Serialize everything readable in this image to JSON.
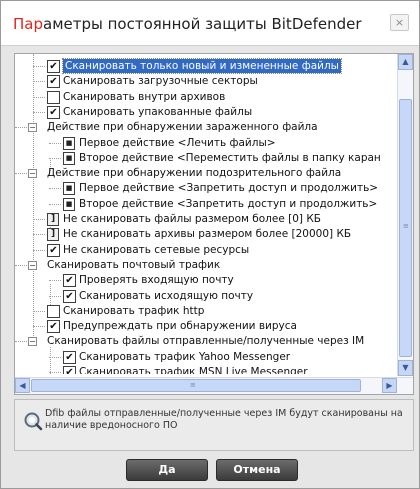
{
  "dialog": {
    "title_highlight": "Пар",
    "title_rest": "аметры постоянной защиты BitDefender",
    "close_glyph": "×"
  },
  "tree": [
    {
      "text": "Сканировать только новый и измененные файлы",
      "type": "checkbox",
      "checked": true,
      "selected": true
    },
    {
      "text": "Сканировать загрузочные секторы",
      "type": "checkbox",
      "checked": true
    },
    {
      "text": "Сканировать внутри архивов",
      "type": "checkbox",
      "checked": false
    },
    {
      "text": "Сканировать упакованные файлы",
      "type": "checkbox",
      "checked": true
    },
    {
      "text": "Действие при обнаружении зараженного файла",
      "type": "group"
    },
    {
      "text": "Первое действие <Лечить файлы>",
      "type": "action"
    },
    {
      "text": "Второе действие <Переместить файлы в папку каран",
      "type": "action"
    },
    {
      "text": "Действие при обнаружении подозрительного файла",
      "type": "group"
    },
    {
      "text": "Первое действие <Запретить доступ и продолжить>",
      "type": "action"
    },
    {
      "text": "Второе действие <Запретить доступ и продолжить>",
      "type": "action"
    },
    {
      "text": "Не сканировать файлы размером более [0] КБ",
      "type": "numeric"
    },
    {
      "text": "Не сканировать архивы размером более [20000] КБ",
      "type": "numeric"
    },
    {
      "text": "Не сканировать сетевые ресурсы",
      "type": "checkbox",
      "checked": true
    },
    {
      "text": "Сканировать почтовый трафик",
      "type": "group"
    },
    {
      "text": "Проверять входящую почту",
      "type": "checkbox",
      "checked": true
    },
    {
      "text": "Сканировать исходящую почту",
      "type": "checkbox",
      "checked": true
    },
    {
      "text": "Сканировать трафик http",
      "type": "checkbox",
      "checked": false
    },
    {
      "text": "Предупреждать при обнаружении вируса",
      "type": "checkbox",
      "checked": true
    },
    {
      "text": "Сканировать файлы отправленные/полученные через IM",
      "type": "group"
    },
    {
      "text": "Сканировать трафик Yahoo Messenger",
      "type": "checkbox",
      "checked": true
    },
    {
      "text": "Сканировать трафик MSN Live Messenger",
      "type": "checkbox",
      "checked": true
    }
  ],
  "scrollbars": {
    "up": "▲",
    "down": "▼",
    "left": "◀",
    "right": "▶",
    "grip": "≡"
  },
  "info": {
    "text": "Dfib файлы отправленные/полученные через IM будут сканированы на наличие вредоносного ПО"
  },
  "buttons": {
    "ok": "Да",
    "cancel": "Отмена"
  }
}
